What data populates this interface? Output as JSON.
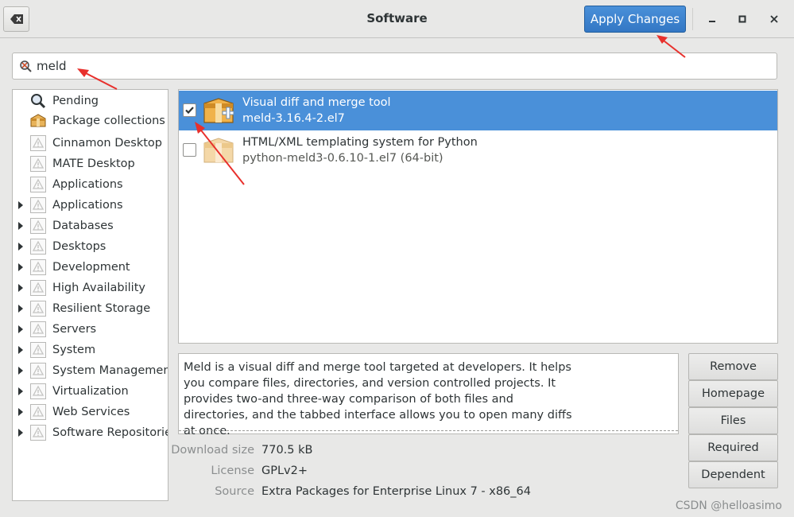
{
  "window": {
    "title": "Software",
    "apply_label": "Apply Changes",
    "minimize": "minimize",
    "maximize": "maximize",
    "close": "close"
  },
  "search": {
    "value": "meld"
  },
  "sidebar": {
    "top_items": [
      {
        "label": "Pending",
        "icon": "search-icon"
      },
      {
        "label": "Package collections",
        "icon": "package-icon"
      }
    ],
    "groups": [
      {
        "label": "Cinnamon Desktop",
        "expandable": false
      },
      {
        "label": "MATE Desktop",
        "expandable": false
      },
      {
        "label": "Applications",
        "expandable": false
      },
      {
        "label": "Applications",
        "expandable": true
      },
      {
        "label": "Databases",
        "expandable": true
      },
      {
        "label": "Desktops",
        "expandable": true
      },
      {
        "label": "Development",
        "expandable": true
      },
      {
        "label": "High Availability",
        "expandable": true
      },
      {
        "label": "Resilient Storage",
        "expandable": true
      },
      {
        "label": "Servers",
        "expandable": true
      },
      {
        "label": "System",
        "expandable": true
      },
      {
        "label": "System Management",
        "expandable": true
      },
      {
        "label": "Virtualization",
        "expandable": true
      },
      {
        "label": "Web Services",
        "expandable": true
      },
      {
        "label": "Software Repositories",
        "expandable": true
      }
    ]
  },
  "packages": [
    {
      "summary": "Visual diff and merge tool",
      "name": "meld-3.16.4-2.el7",
      "checked": true,
      "selected": true
    },
    {
      "summary": "HTML/XML templating system for Python",
      "name": "python-meld3-0.6.10-1.el7 (64-bit)",
      "checked": false,
      "selected": false
    }
  ],
  "description": "Meld is a visual diff and merge tool targeted at developers. It helps you compare files, directories, and version controlled projects. It provides two-and three-way comparison of both files and directories, and the tabbed interface allows you to open many diffs at once.",
  "details": [
    {
      "label": "Download size",
      "value": "770.5 kB"
    },
    {
      "label": "License",
      "value": "GPLv2+"
    },
    {
      "label": "Source",
      "value": "Extra Packages for Enterprise Linux 7 - x86_64"
    }
  ],
  "actions": {
    "remove": "Remove",
    "homepage": "Homepage",
    "files": "Files",
    "required": "Required",
    "dependent": "Dependent"
  },
  "watermark": "CSDN @helloasimo",
  "colors": {
    "accent": "#4a90d9",
    "annotation_arrow": "#e8302c"
  }
}
